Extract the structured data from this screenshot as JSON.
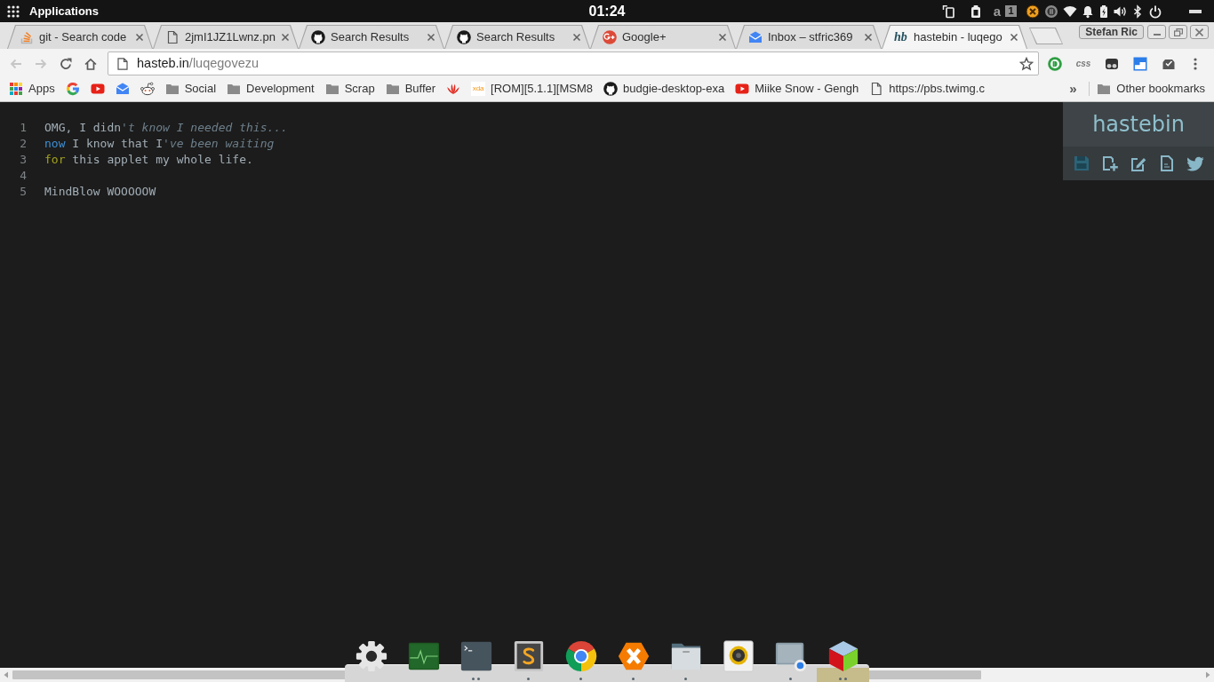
{
  "top_panel": {
    "menu_label": "Applications",
    "clock": "01:24",
    "indicators": [
      "a",
      "1"
    ]
  },
  "browser": {
    "tabs": [
      {
        "title": "git - Search code",
        "selected": false
      },
      {
        "title": "2jmI1JZ1Lwnz.pn",
        "selected": false
      },
      {
        "title": "Search Results",
        "selected": false
      },
      {
        "title": "Search Results",
        "selected": false
      },
      {
        "title": "Google+",
        "selected": false
      },
      {
        "title": "Inbox – stfric369",
        "selected": false
      },
      {
        "title": "hastebin - luqego",
        "favicon_text": "hb",
        "selected": true
      }
    ],
    "profile": "Stefan Ric",
    "back": {
      "disabled": true
    },
    "forward": {
      "disabled": true
    },
    "address": {
      "host": "hasteb.in",
      "path": "/luqegovezu"
    },
    "extension_label": "css",
    "bookmarks": [
      {
        "kind": "apps",
        "label": "Apps"
      },
      {
        "kind": "link"
      },
      {
        "kind": "link"
      },
      {
        "kind": "link"
      },
      {
        "kind": "link"
      },
      {
        "kind": "folder",
        "label": "Social"
      },
      {
        "kind": "folder",
        "label": "Development"
      },
      {
        "kind": "folder",
        "label": "Scrap"
      },
      {
        "kind": "folder",
        "label": "Buffer"
      },
      {
        "kind": "link"
      },
      {
        "kind": "link",
        "favicon_text": "xda",
        "label": "[ROM][5.1.1][MSM8"
      },
      {
        "kind": "link",
        "label": "budgie-desktop-exa"
      },
      {
        "kind": "link",
        "label": "Miike Snow - Gengh"
      },
      {
        "kind": "link",
        "label": "https://pbs.twimg.c"
      }
    ],
    "bookmarks_overflow": "»",
    "other_bookmarks": "Other bookmarks"
  },
  "editor": {
    "lines": [
      {
        "number": "1",
        "tokens": [
          {
            "kind": "plain",
            "text": "OMG, I didn"
          },
          {
            "kind": "string",
            "text": "'t know I needed this..."
          }
        ]
      },
      {
        "number": "2",
        "tokens": [
          {
            "kind": "builtin",
            "text": "now"
          },
          {
            "kind": "plain",
            "text": " I know that I"
          },
          {
            "kind": "string",
            "text": "'ve been waiting"
          }
        ]
      },
      {
        "number": "3",
        "tokens": [
          {
            "kind": "keyword",
            "text": "for"
          },
          {
            "kind": "plain",
            "text": " this applet my whole life."
          }
        ]
      },
      {
        "number": "4"
      },
      {
        "number": "5",
        "tokens": [
          {
            "kind": "plain",
            "text": "MindBlow WOOOOOW"
          }
        ]
      }
    ]
  },
  "tool_panel": {
    "logo": "hastebin",
    "actions": [
      {
        "disabled": true
      },
      {
        "disabled": false
      },
      {
        "disabled": false
      },
      {
        "disabled": false
      },
      {
        "disabled": false
      }
    ]
  },
  "dock": {
    "items": [
      {
        "running": false,
        "multiple": false,
        "selected": false
      },
      {
        "running": false,
        "multiple": false,
        "selected": false
      },
      {
        "running": true,
        "multiple": true,
        "selected": false
      },
      {
        "running": true,
        "multiple": false,
        "selected": false
      },
      {
        "running": true,
        "multiple": false,
        "selected": false
      },
      {
        "running": true,
        "multiple": false,
        "selected": false
      },
      {
        "running": true,
        "multiple": false,
        "selected": false
      },
      {
        "running": false,
        "multiple": false,
        "selected": false
      },
      {
        "running": true,
        "multiple": false,
        "selected": false
      },
      {
        "running": true,
        "multiple": true,
        "selected": true
      }
    ]
  }
}
